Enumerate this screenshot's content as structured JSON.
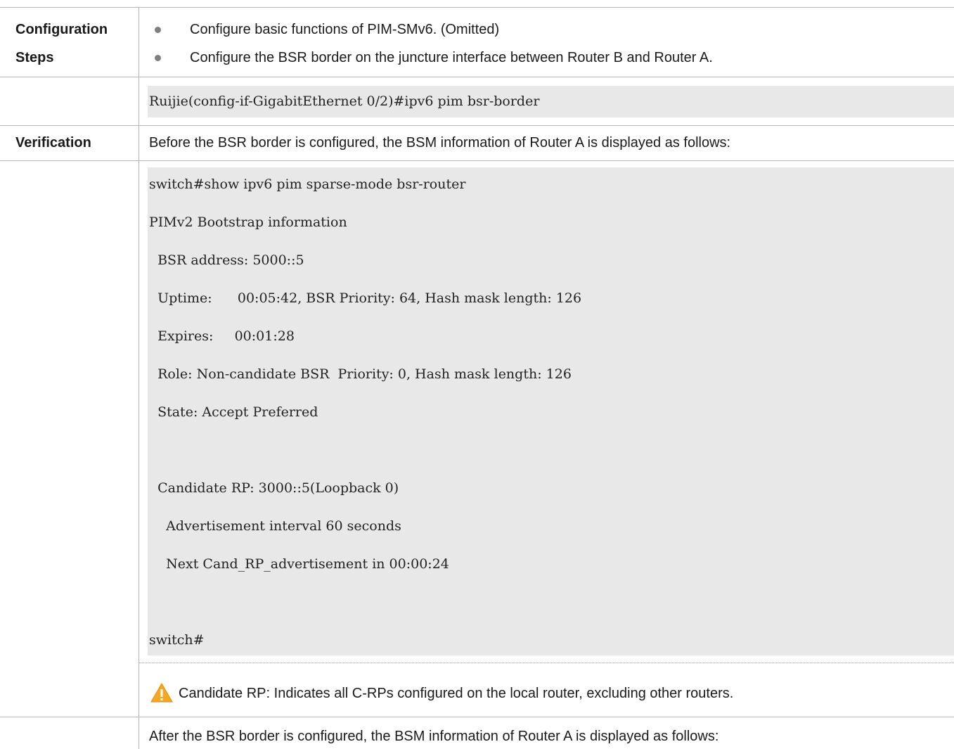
{
  "row1": {
    "label_line1": "Configuration",
    "label_line2": "Steps",
    "bullets": [
      "Configure basic functions of PIM-SMv6. (Omitted)",
      "Configure the BSR border on the juncture interface between Router B and Router A."
    ]
  },
  "row2": {
    "command": "Ruijie(config-if-GigabitEthernet 0/2)#ipv6 pim bsr-border"
  },
  "row3": {
    "label": "Verification",
    "text": "Before the BSR border is configured, the BSM information of Router A is displayed as follows:"
  },
  "row4": {
    "lines": [
      "switch#show ipv6 pim sparse-mode bsr-router",
      "PIMv2 Bootstrap information",
      "  BSR address: 5000::5",
      "  Uptime:      00:05:42, BSR Priority: 64, Hash mask length: 126",
      "  Expires:     00:01:28",
      "  Role: Non-candidate BSR  Priority: 0, Hash mask length: 126",
      "  State: Accept Preferred",
      "",
      "  Candidate RP: 3000::5(Loopback 0)",
      "    Advertisement interval 60 seconds",
      "    Next Cand_RP_advertisement in 00:00:24",
      "",
      "switch#"
    ]
  },
  "row5": {
    "icon": "warning-icon",
    "note": "Candidate RP: Indicates all C-RPs configured on the local router, excluding other routers."
  },
  "row6": {
    "text": "After the BSR border is configured, the BSM information of Router A is displayed as follows:"
  }
}
